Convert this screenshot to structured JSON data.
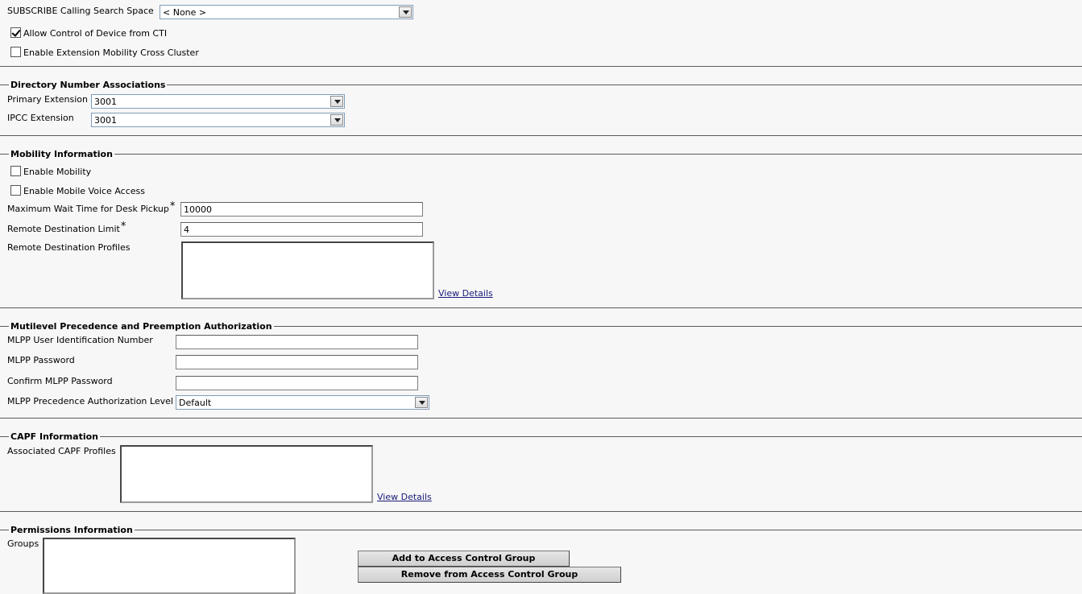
{
  "top": {
    "subscribe_css_label": "SUBSCRIBE Calling Search Space",
    "subscribe_css_value": "< None >",
    "allow_cti_label": "Allow Control of Device from CTI",
    "allow_cti_checked": true,
    "ext_mobility_label": "Enable Extension Mobility Cross Cluster",
    "ext_mobility_checked": false
  },
  "directory": {
    "legend": "Directory Number Associations",
    "primary_label": "Primary Extension",
    "primary_value": "3001",
    "ipcc_label": "IPCC Extension",
    "ipcc_value": "3001"
  },
  "mobility": {
    "legend": "Mobility Information",
    "enable_mobility_label": "Enable Mobility",
    "enable_mobility_checked": false,
    "mobile_voice_label": "Enable Mobile Voice Access",
    "mobile_voice_checked": false,
    "max_wait_label": "Maximum Wait Time for Desk Pickup",
    "max_wait_value": "10000",
    "remote_limit_label": "Remote Destination Limit",
    "remote_limit_value": "4",
    "required_mark": "*",
    "profiles_label": "Remote Destination Profiles",
    "view_details": "View Details"
  },
  "mlpp": {
    "legend": "Mutilevel Precedence and Preemption Authorization",
    "uid_label": "MLPP User Identification Number",
    "uid_value": "",
    "password_label": "MLPP Password",
    "password_value": "",
    "confirm_label": "Confirm MLPP Password",
    "confirm_value": "",
    "level_label": "MLPP Precedence Authorization Level",
    "level_value": "Default"
  },
  "capf": {
    "legend": "CAPF Information",
    "profiles_label": "Associated CAPF Profiles",
    "view_details": "View Details"
  },
  "permissions": {
    "legend": "Permissions Information",
    "groups_label": "Groups",
    "add_button": "Add to Access Control Group",
    "remove_button": "Remove from Access Control Group"
  }
}
